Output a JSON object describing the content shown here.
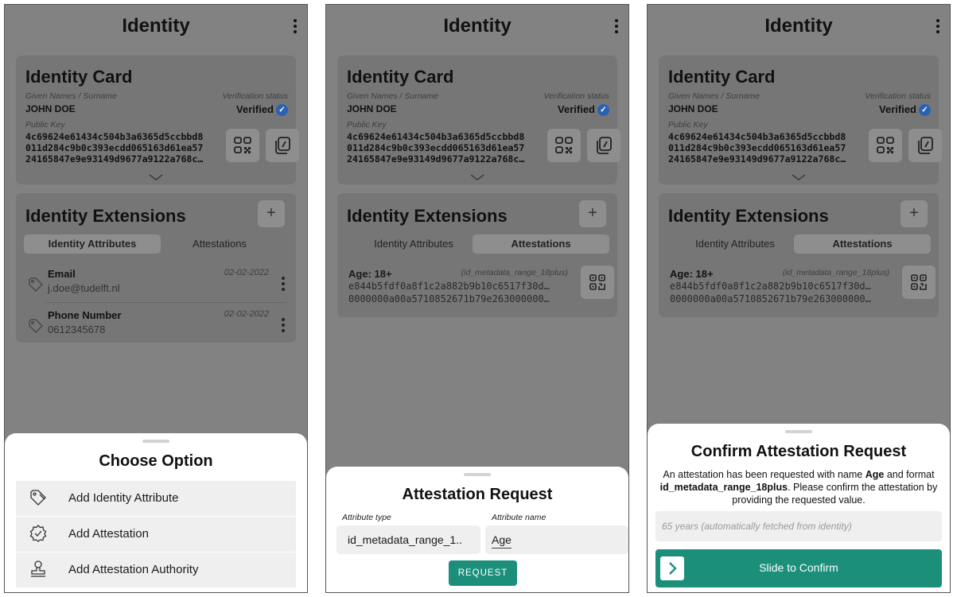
{
  "app": {
    "title": "Identity"
  },
  "identity_card": {
    "title": "Identity Card",
    "names_label": "Given Names / Surname",
    "name": "JOHN DOE",
    "verification_label": "Verification status",
    "verification_value": "Verified",
    "public_key_label": "Public Key",
    "public_key_lines": [
      "4c69624e61434c504b3a6365d5ccbbd8",
      "011d284c9b0c393ecdd065163d61ea57",
      "24165847e9e93149d9677a9122a768c…"
    ]
  },
  "extensions": {
    "title": "Identity Extensions",
    "add_label": "+",
    "tabs": [
      "Identity Attributes",
      "Attestations"
    ],
    "attributes": [
      {
        "label": "Email",
        "value": "j.doe@tudelft.nl",
        "date": "02-02-2022"
      },
      {
        "label": "Phone Number",
        "value": "0612345678",
        "date": "02-02-2022"
      }
    ],
    "attestation": {
      "name": "Age: 18+",
      "format": "(id_metadata_range_18plus)",
      "hash_lines": [
        "e844b5fdf0a8f1c2a882b9b10c6517f30d…",
        "0000000a00a5710852671b79e263000000…"
      ]
    }
  },
  "choose_option": {
    "title": "Choose Option",
    "options": [
      {
        "label": "Add Identity Attribute",
        "icon": "tag-icon"
      },
      {
        "label": "Add Attestation",
        "icon": "badge-check-icon"
      },
      {
        "label": "Add Attestation Authority",
        "icon": "stamp-icon"
      }
    ]
  },
  "attestation_request": {
    "title": "Attestation Request",
    "type_label": "Attribute type",
    "type_value": "id_metadata_range_1..",
    "name_label": "Attribute name",
    "name_value": "Age",
    "button": "REQUEST"
  },
  "confirm_request": {
    "title": "Confirm Attestation Request",
    "text_1": "An attestation has been requested with name ",
    "attr_name": "Age",
    "text_2": " and format ",
    "format": "id_metadata_range_18plus",
    "text_3": ". Please confirm the attestation by providing the requested value.",
    "placeholder": "65 years (automatically fetched from identity)",
    "slider_label": "Slide to Confirm"
  },
  "colors": {
    "accent": "#1c8f7b",
    "verified": "#2a62b3",
    "scrim": "#828282"
  }
}
